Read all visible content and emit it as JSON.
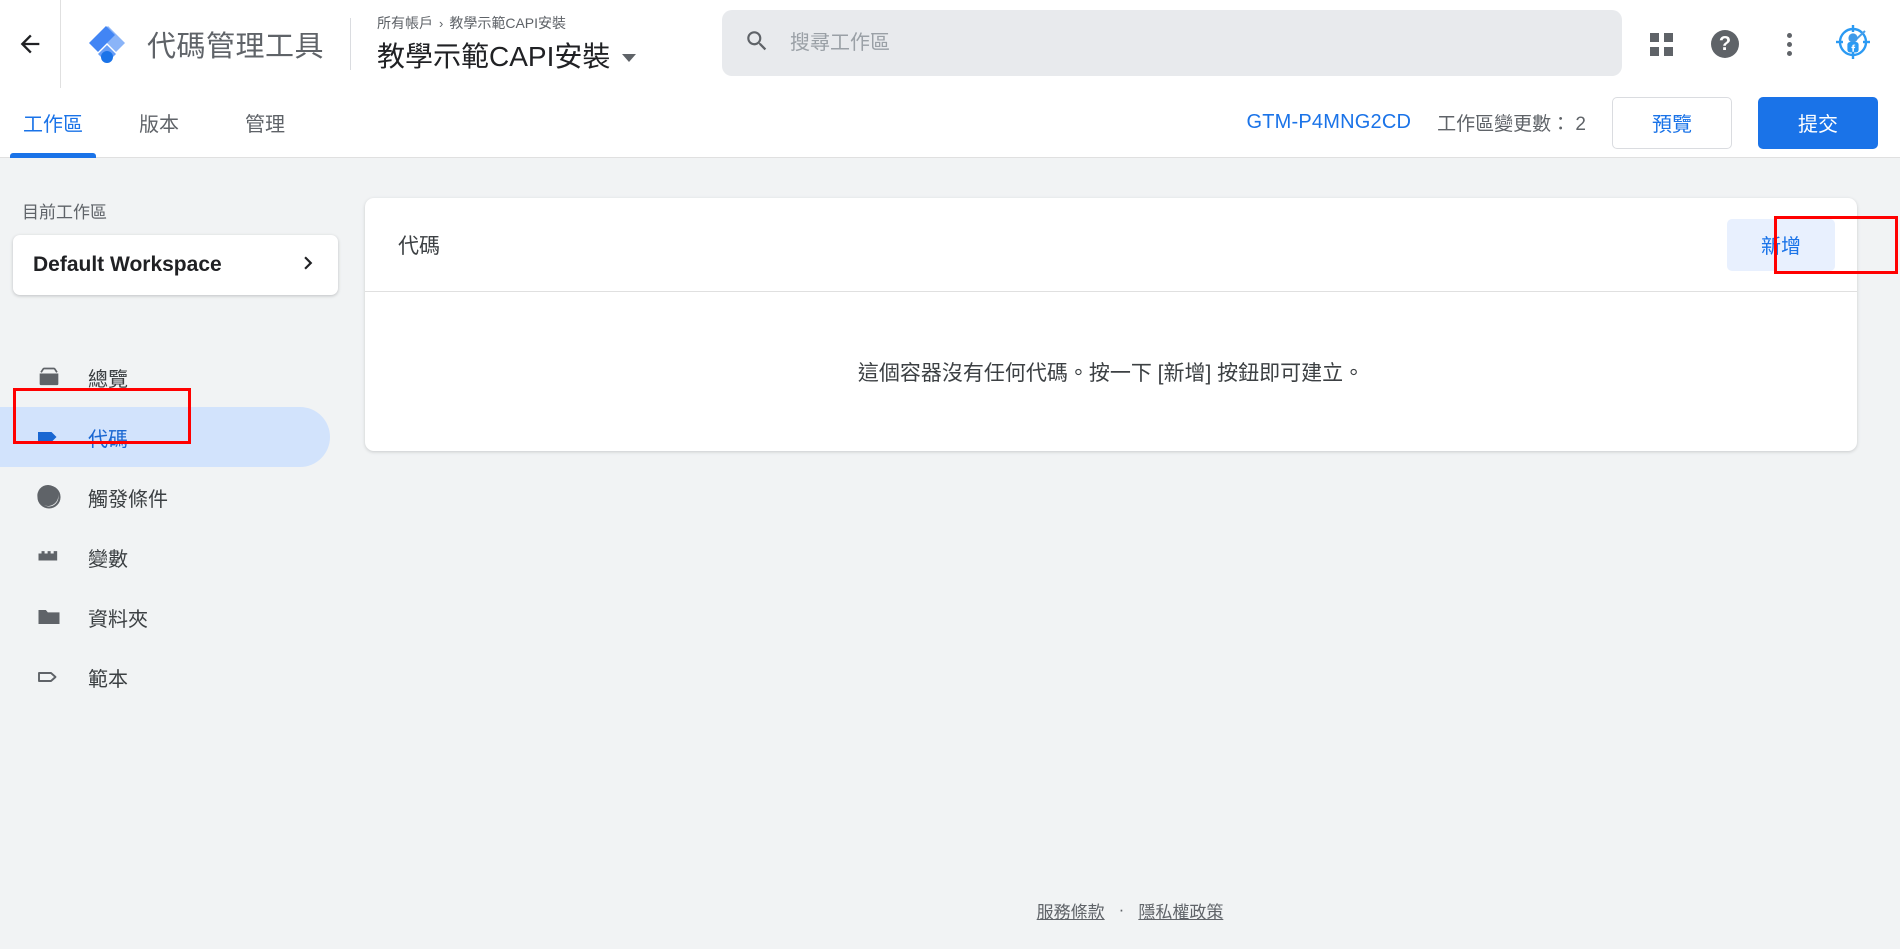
{
  "header": {
    "back_icon": "arrow-left-icon",
    "logo_icon": "gtm-diamond-logo",
    "brand": "代碼管理工具",
    "breadcrumb_root": "所有帳戶",
    "breadcrumb_sep": "›",
    "breadcrumb_current": "教學示範CAPI安裝",
    "container_name": "教學示範CAPI安裝",
    "search": {
      "icon": "search-icon",
      "value": "",
      "placeholder": "搜尋工作區"
    },
    "actions": {
      "apps_icon": "apps-grid-icon",
      "help_icon": "help-circle-icon",
      "help_glyph": "?",
      "more_icon": "kebab-menu-icon",
      "avatar_icon": "facebook-pixel-helper-avatar-icon"
    }
  },
  "tabbar": {
    "tabs": [
      {
        "label": "工作區",
        "active": true
      },
      {
        "label": "版本",
        "active": false
      },
      {
        "label": "管理",
        "active": false
      }
    ],
    "container_id": "GTM-P4MNG2CD",
    "changes_text": "工作區變更數： 2",
    "preview_label": "預覽",
    "submit_label": "提交"
  },
  "sidebar": {
    "current_workspace_label": "目前工作區",
    "workspace_name": "Default Workspace",
    "workspace_chevron": "chevron-right-icon",
    "items": [
      {
        "label": "總覽",
        "icon": "container-box-icon",
        "selected": false
      },
      {
        "label": "代碼",
        "icon": "tag-icon",
        "selected": true
      },
      {
        "label": "觸發條件",
        "icon": "trigger-circle-icon",
        "selected": false
      },
      {
        "label": "變數",
        "icon": "variable-blocks-icon",
        "selected": false
      },
      {
        "label": "資料夾",
        "icon": "folder-icon",
        "selected": false
      },
      {
        "label": "範本",
        "icon": "template-tag-outline-icon",
        "selected": false
      }
    ]
  },
  "main": {
    "card_title": "代碼",
    "new_button_label": "新增",
    "empty_message": "這個容器沒有任何代碼。按一下 [新增] 按鈕即可建立。"
  },
  "footer": {
    "terms_label": "服務條款",
    "separator": "·",
    "privacy_label": "隱私權政策"
  },
  "annotations": {
    "color": "#ff0000",
    "nav_highlight_target": "代碼",
    "new_button_highlight_target": "新增"
  },
  "colors": {
    "accent_blue": "#1a73e8",
    "selected_pill": "#d2e3fc",
    "selected_text": "#1967d2",
    "page_bg": "#f1f3f4",
    "card_bg": "#ffffff",
    "text_primary": "#202124",
    "text_secondary": "#5f6368",
    "annotation_red": "#ff0000"
  }
}
